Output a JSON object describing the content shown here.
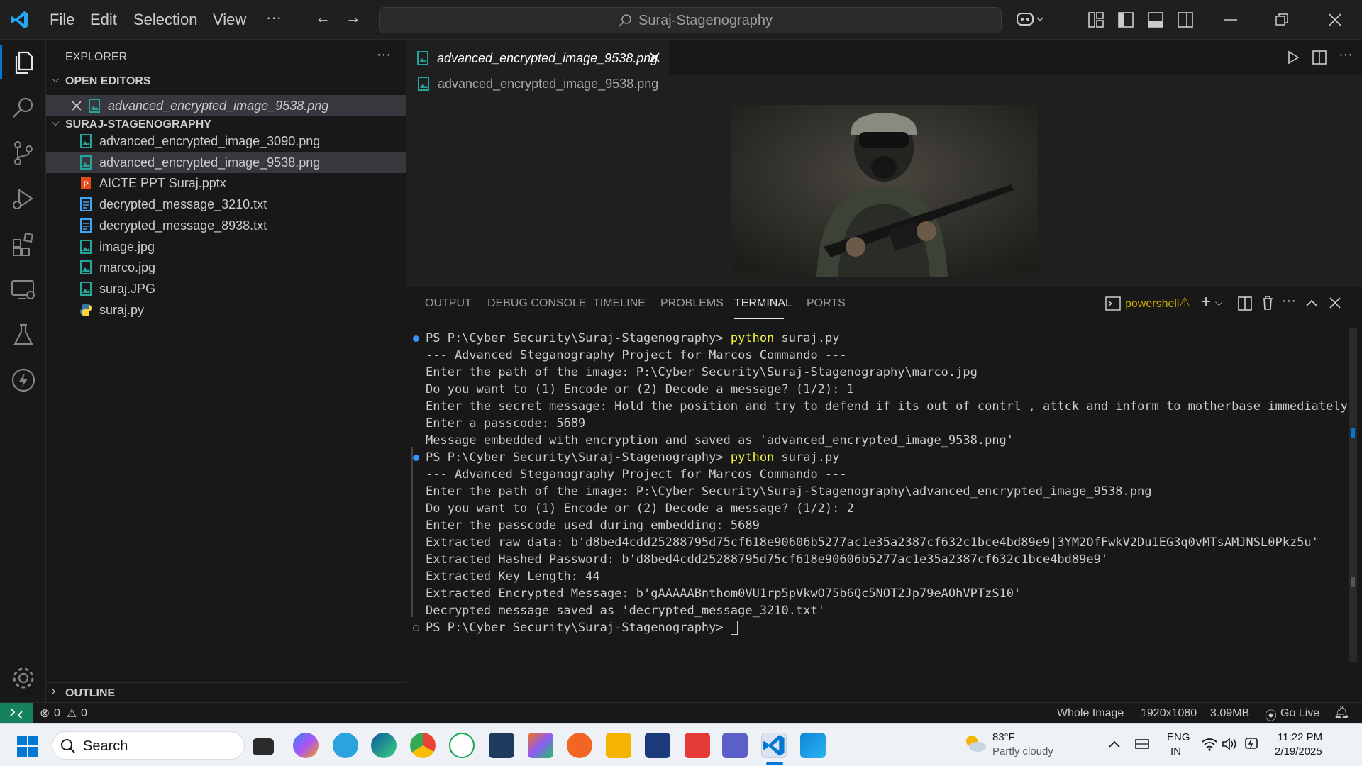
{
  "titlebar": {
    "menu": [
      "File",
      "Edit",
      "Selection",
      "View"
    ],
    "more": "···",
    "search_text": "Suraj-Stagenography"
  },
  "sidebar": {
    "title": "EXPLORER",
    "open_editors_label": "OPEN EDITORS",
    "open_editor_file": "advanced_encrypted_image_9538.png",
    "folder_label": "SURAJ-STAGENOGRAPHY",
    "files": [
      {
        "name": "advanced_encrypted_image_3090.png",
        "type": "image"
      },
      {
        "name": "advanced_encrypted_image_9538.png",
        "type": "image"
      },
      {
        "name": "AICTE PPT Suraj.pptx",
        "type": "ppt"
      },
      {
        "name": "decrypted_message_3210.txt",
        "type": "text"
      },
      {
        "name": "decrypted_message_8938.txt",
        "type": "text"
      },
      {
        "name": "image.jpg",
        "type": "image"
      },
      {
        "name": "marco.jpg",
        "type": "image"
      },
      {
        "name": "suraj.JPG",
        "type": "image"
      },
      {
        "name": "suraj.py",
        "type": "python"
      }
    ],
    "outline_label": "OUTLINE"
  },
  "editor": {
    "tab_label": "advanced_encrypted_image_9538.png",
    "breadcrumb": "advanced_encrypted_image_9538.png"
  },
  "panel": {
    "tabs": [
      "OUTPUT",
      "DEBUG CONSOLE",
      "TIMELINE",
      "PROBLEMS",
      "TERMINAL",
      "PORTS"
    ],
    "active_tab": "TERMINAL",
    "shell_label": "powershell",
    "terminal_lines": [
      {
        "prompt": "PS P:\\Cyber Security\\Suraj-Stagenography> ",
        "cmd": "python",
        "rest": " suraj.py",
        "marker": "blue"
      },
      {
        "text": "--- Advanced Steganography Project for Marcos Commando ---"
      },
      {
        "text": "Enter the path of the image: P:\\Cyber Security\\Suraj-Stagenography\\marco.jpg"
      },
      {
        "text": "Do you want to (1) Encode or (2) Decode a message? (1/2): 1"
      },
      {
        "text": "Enter the secret message: Hold the position and try to defend if its out of contrl , attck and inform to motherbase immediately."
      },
      {
        "text": "Enter a passcode: 5689"
      },
      {
        "text": "Message embedded with encryption and saved as 'advanced_encrypted_image_9538.png'"
      },
      {
        "prompt": "PS P:\\Cyber Security\\Suraj-Stagenography> ",
        "cmd": "python",
        "rest": " suraj.py",
        "marker": "blue"
      },
      {
        "text": "--- Advanced Steganography Project for Marcos Commando ---"
      },
      {
        "text": "Enter the path of the image: P:\\Cyber Security\\Suraj-Stagenography\\advanced_encrypted_image_9538.png"
      },
      {
        "text": "Do you want to (1) Encode or (2) Decode a message? (1/2): 2"
      },
      {
        "text": "Enter the passcode used during embedding: 5689"
      },
      {
        "text": "Extracted raw data: b'd8bed4cdd25288795d75cf618e90606b5277ac1e35a2387cf632c1bce4bd89e9|3YM2OfFwkV2Du1EG3q0vMTsAMJNSL0Pkz5u'"
      },
      {
        "text": "Extracted Hashed Password: b'd8bed4cdd25288795d75cf618e90606b5277ac1e35a2387cf632c1bce4bd89e9'"
      },
      {
        "text": "Extracted Key Length: 44"
      },
      {
        "text": "Extracted Encrypted Message: b'gAAAAABnthom0VU1rp5pVkwO75b6Qc5NOT2Jp79eAOhVPTzS10'"
      },
      {
        "text": "Decrypted message saved as 'decrypted_message_3210.txt'"
      },
      {
        "prompt": "PS P:\\Cyber Security\\Suraj-Stagenography> ",
        "cmd": "",
        "rest": "",
        "marker": "hollow",
        "cursor": true
      }
    ]
  },
  "statusbar": {
    "errors": "0",
    "warnings": "0",
    "image_mode": "Whole Image",
    "dimensions": "1920x1080",
    "size": "3.09MB",
    "go_live": "Go Live"
  },
  "taskbar": {
    "search_label": "Search",
    "weather_temp": "83°F",
    "weather_desc": "Partly cloudy",
    "lang": "ENG",
    "region": "IN",
    "time": "11:22 PM",
    "date": "2/19/2025"
  },
  "colors": {
    "accent": "#0078d4",
    "warning": "#cca700",
    "terminal_cmd": "#f5f543",
    "remote": "#16825d"
  }
}
